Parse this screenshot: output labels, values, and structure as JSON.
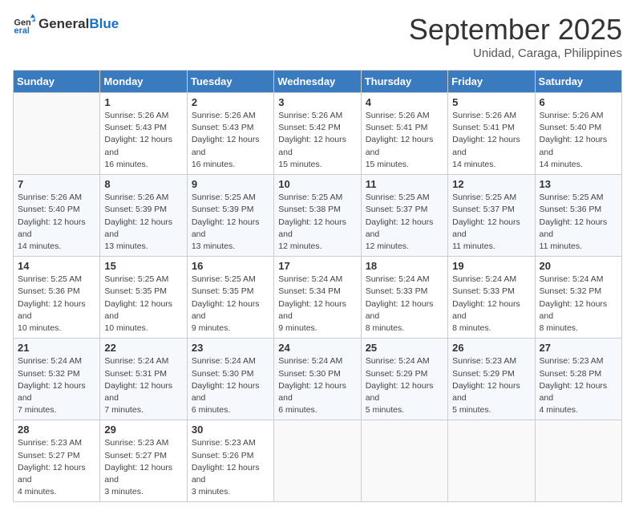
{
  "header": {
    "logo_general": "General",
    "logo_blue": "Blue",
    "month": "September 2025",
    "location": "Unidad, Caraga, Philippines"
  },
  "days_of_week": [
    "Sunday",
    "Monday",
    "Tuesday",
    "Wednesday",
    "Thursday",
    "Friday",
    "Saturday"
  ],
  "weeks": [
    [
      {
        "num": "",
        "empty": true
      },
      {
        "num": "1",
        "sunrise": "Sunrise: 5:26 AM",
        "sunset": "Sunset: 5:43 PM",
        "daylight": "Daylight: 12 hours and 16 minutes."
      },
      {
        "num": "2",
        "sunrise": "Sunrise: 5:26 AM",
        "sunset": "Sunset: 5:43 PM",
        "daylight": "Daylight: 12 hours and 16 minutes."
      },
      {
        "num": "3",
        "sunrise": "Sunrise: 5:26 AM",
        "sunset": "Sunset: 5:42 PM",
        "daylight": "Daylight: 12 hours and 15 minutes."
      },
      {
        "num": "4",
        "sunrise": "Sunrise: 5:26 AM",
        "sunset": "Sunset: 5:41 PM",
        "daylight": "Daylight: 12 hours and 15 minutes."
      },
      {
        "num": "5",
        "sunrise": "Sunrise: 5:26 AM",
        "sunset": "Sunset: 5:41 PM",
        "daylight": "Daylight: 12 hours and 14 minutes."
      },
      {
        "num": "6",
        "sunrise": "Sunrise: 5:26 AM",
        "sunset": "Sunset: 5:40 PM",
        "daylight": "Daylight: 12 hours and 14 minutes."
      }
    ],
    [
      {
        "num": "7",
        "sunrise": "Sunrise: 5:26 AM",
        "sunset": "Sunset: 5:40 PM",
        "daylight": "Daylight: 12 hours and 14 minutes."
      },
      {
        "num": "8",
        "sunrise": "Sunrise: 5:26 AM",
        "sunset": "Sunset: 5:39 PM",
        "daylight": "Daylight: 12 hours and 13 minutes."
      },
      {
        "num": "9",
        "sunrise": "Sunrise: 5:25 AM",
        "sunset": "Sunset: 5:39 PM",
        "daylight": "Daylight: 12 hours and 13 minutes."
      },
      {
        "num": "10",
        "sunrise": "Sunrise: 5:25 AM",
        "sunset": "Sunset: 5:38 PM",
        "daylight": "Daylight: 12 hours and 12 minutes."
      },
      {
        "num": "11",
        "sunrise": "Sunrise: 5:25 AM",
        "sunset": "Sunset: 5:37 PM",
        "daylight": "Daylight: 12 hours and 12 minutes."
      },
      {
        "num": "12",
        "sunrise": "Sunrise: 5:25 AM",
        "sunset": "Sunset: 5:37 PM",
        "daylight": "Daylight: 12 hours and 11 minutes."
      },
      {
        "num": "13",
        "sunrise": "Sunrise: 5:25 AM",
        "sunset": "Sunset: 5:36 PM",
        "daylight": "Daylight: 12 hours and 11 minutes."
      }
    ],
    [
      {
        "num": "14",
        "sunrise": "Sunrise: 5:25 AM",
        "sunset": "Sunset: 5:36 PM",
        "daylight": "Daylight: 12 hours and 10 minutes."
      },
      {
        "num": "15",
        "sunrise": "Sunrise: 5:25 AM",
        "sunset": "Sunset: 5:35 PM",
        "daylight": "Daylight: 12 hours and 10 minutes."
      },
      {
        "num": "16",
        "sunrise": "Sunrise: 5:25 AM",
        "sunset": "Sunset: 5:35 PM",
        "daylight": "Daylight: 12 hours and 9 minutes."
      },
      {
        "num": "17",
        "sunrise": "Sunrise: 5:24 AM",
        "sunset": "Sunset: 5:34 PM",
        "daylight": "Daylight: 12 hours and 9 minutes."
      },
      {
        "num": "18",
        "sunrise": "Sunrise: 5:24 AM",
        "sunset": "Sunset: 5:33 PM",
        "daylight": "Daylight: 12 hours and 8 minutes."
      },
      {
        "num": "19",
        "sunrise": "Sunrise: 5:24 AM",
        "sunset": "Sunset: 5:33 PM",
        "daylight": "Daylight: 12 hours and 8 minutes."
      },
      {
        "num": "20",
        "sunrise": "Sunrise: 5:24 AM",
        "sunset": "Sunset: 5:32 PM",
        "daylight": "Daylight: 12 hours and 8 minutes."
      }
    ],
    [
      {
        "num": "21",
        "sunrise": "Sunrise: 5:24 AM",
        "sunset": "Sunset: 5:32 PM",
        "daylight": "Daylight: 12 hours and 7 minutes."
      },
      {
        "num": "22",
        "sunrise": "Sunrise: 5:24 AM",
        "sunset": "Sunset: 5:31 PM",
        "daylight": "Daylight: 12 hours and 7 minutes."
      },
      {
        "num": "23",
        "sunrise": "Sunrise: 5:24 AM",
        "sunset": "Sunset: 5:30 PM",
        "daylight": "Daylight: 12 hours and 6 minutes."
      },
      {
        "num": "24",
        "sunrise": "Sunrise: 5:24 AM",
        "sunset": "Sunset: 5:30 PM",
        "daylight": "Daylight: 12 hours and 6 minutes."
      },
      {
        "num": "25",
        "sunrise": "Sunrise: 5:24 AM",
        "sunset": "Sunset: 5:29 PM",
        "daylight": "Daylight: 12 hours and 5 minutes."
      },
      {
        "num": "26",
        "sunrise": "Sunrise: 5:23 AM",
        "sunset": "Sunset: 5:29 PM",
        "daylight": "Daylight: 12 hours and 5 minutes."
      },
      {
        "num": "27",
        "sunrise": "Sunrise: 5:23 AM",
        "sunset": "Sunset: 5:28 PM",
        "daylight": "Daylight: 12 hours and 4 minutes."
      }
    ],
    [
      {
        "num": "28",
        "sunrise": "Sunrise: 5:23 AM",
        "sunset": "Sunset: 5:27 PM",
        "daylight": "Daylight: 12 hours and 4 minutes."
      },
      {
        "num": "29",
        "sunrise": "Sunrise: 5:23 AM",
        "sunset": "Sunset: 5:27 PM",
        "daylight": "Daylight: 12 hours and 3 minutes."
      },
      {
        "num": "30",
        "sunrise": "Sunrise: 5:23 AM",
        "sunset": "Sunset: 5:26 PM",
        "daylight": "Daylight: 12 hours and 3 minutes."
      },
      {
        "num": "",
        "empty": true
      },
      {
        "num": "",
        "empty": true
      },
      {
        "num": "",
        "empty": true
      },
      {
        "num": "",
        "empty": true
      }
    ]
  ]
}
